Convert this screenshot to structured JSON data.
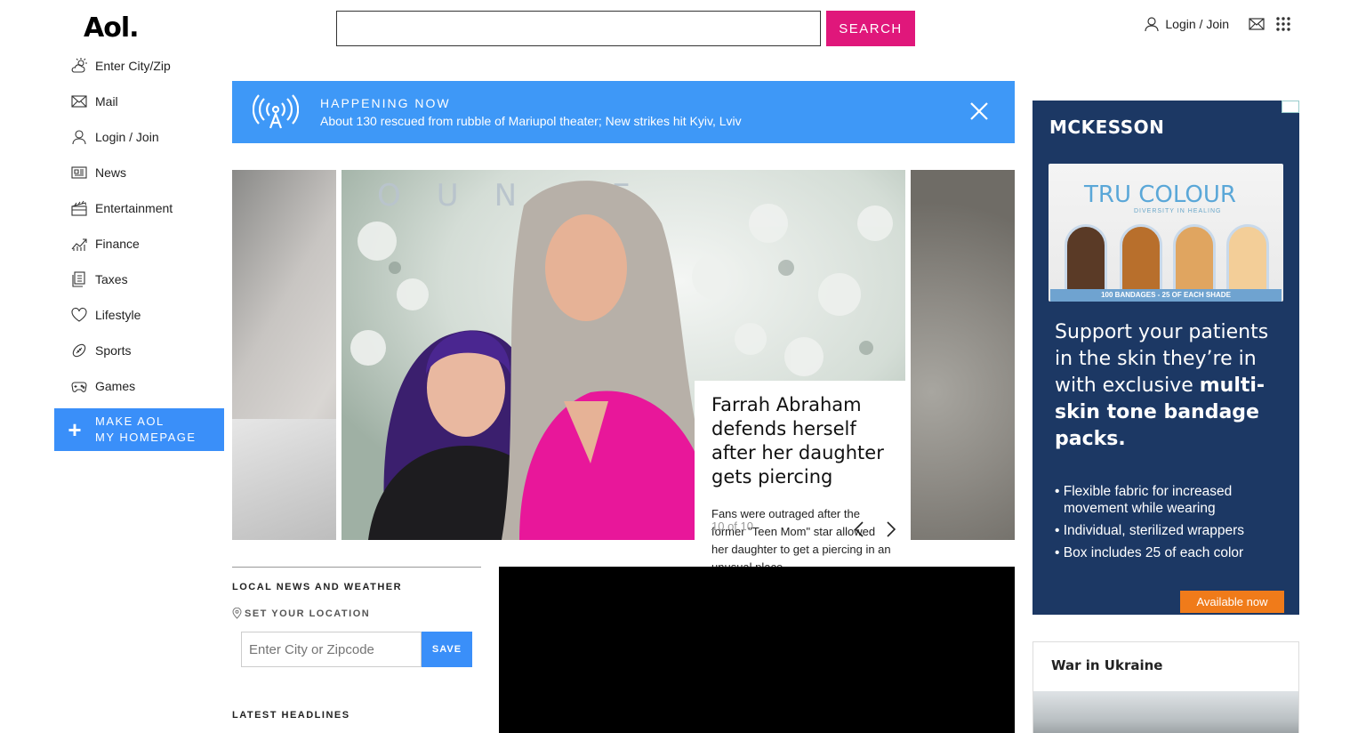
{
  "header": {
    "logo": "Aol.",
    "search_placeholder": "",
    "search_button": "SEARCH",
    "login": "Login / Join"
  },
  "sidebar": {
    "items": [
      {
        "label": "Enter City/Zip",
        "icon": "weather-icon"
      },
      {
        "label": "Mail",
        "icon": "mail-icon"
      },
      {
        "label": "Login / Join",
        "icon": "user-icon"
      },
      {
        "label": "News",
        "icon": "news-icon"
      },
      {
        "label": "Entertainment",
        "icon": "clapper-icon"
      },
      {
        "label": "Finance",
        "icon": "chart-icon"
      },
      {
        "label": "Taxes",
        "icon": "document-icon"
      },
      {
        "label": "Lifestyle",
        "icon": "heart-icon"
      },
      {
        "label": "Sports",
        "icon": "football-icon"
      },
      {
        "label": "Games",
        "icon": "gamepad-icon"
      }
    ],
    "homepage_line1": "MAKE AOL",
    "homepage_line2": "MY HOMEPAGE"
  },
  "banner": {
    "kicker": "HAPPENING NOW",
    "headline": "About 130 rescued from rubble of Mariupol theater; New strikes hit Kyiv, Lviv"
  },
  "carousel": {
    "title": "Farrah Abraham defends herself after her daughter gets piercing",
    "description": "Fans were outraged after the former \"Teen Mom\" star allowed her daughter to get a piercing in an unusual place.",
    "counter": "10 of 10"
  },
  "local": {
    "heading": "LOCAL NEWS AND WEATHER",
    "set_location": "SET YOUR LOCATION",
    "zip_placeholder": "Enter City or Zipcode",
    "save": "SAVE",
    "latest": "LATEST HEADLINES"
  },
  "ad": {
    "brand": "MCKESSON",
    "product": "TRU COLOUR",
    "product_sub": "DIVERSITY IN HEALING",
    "strip": "100 BANDAGES - 25 OF EACH SHADE",
    "copy_plain": "Support your patients in the skin they’re in with exclusive",
    "copy_bold": "multi-skin tone bandage packs.",
    "bullets": [
      "Flexible fabric for increased movement while wearing",
      "Individual, sterilized wrappers",
      "Box includes 25 of each color"
    ],
    "cta": "Available now"
  },
  "war": {
    "title": "War in Ukraine"
  },
  "colors": {
    "search_button": "#e0177b",
    "banner": "#3e98f7",
    "homepage_button": "#3a8ff9",
    "ad_background": "#1c3864",
    "ad_cta": "#f07b1a"
  }
}
